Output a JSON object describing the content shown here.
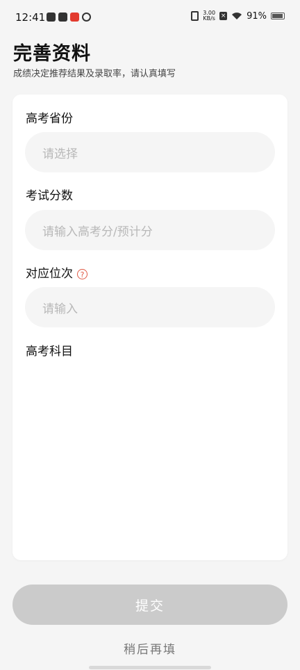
{
  "statusbar": {
    "time": "12:41",
    "speed_value": "3.00",
    "speed_unit": "KB/s",
    "battery": "91%"
  },
  "header": {
    "title": "完善资料",
    "subtitle": "成绩决定推荐结果及录取率，请认真填写"
  },
  "form": {
    "province": {
      "label": "高考省份",
      "placeholder": "请选择"
    },
    "score": {
      "label": "考试分数",
      "placeholder": "请输入高考分/预计分"
    },
    "rank": {
      "label": "对应位次",
      "placeholder": "请输入",
      "help": "?"
    },
    "subjects": {
      "label": "高考科目"
    }
  },
  "actions": {
    "submit": "提交",
    "later": "稍后再填"
  }
}
